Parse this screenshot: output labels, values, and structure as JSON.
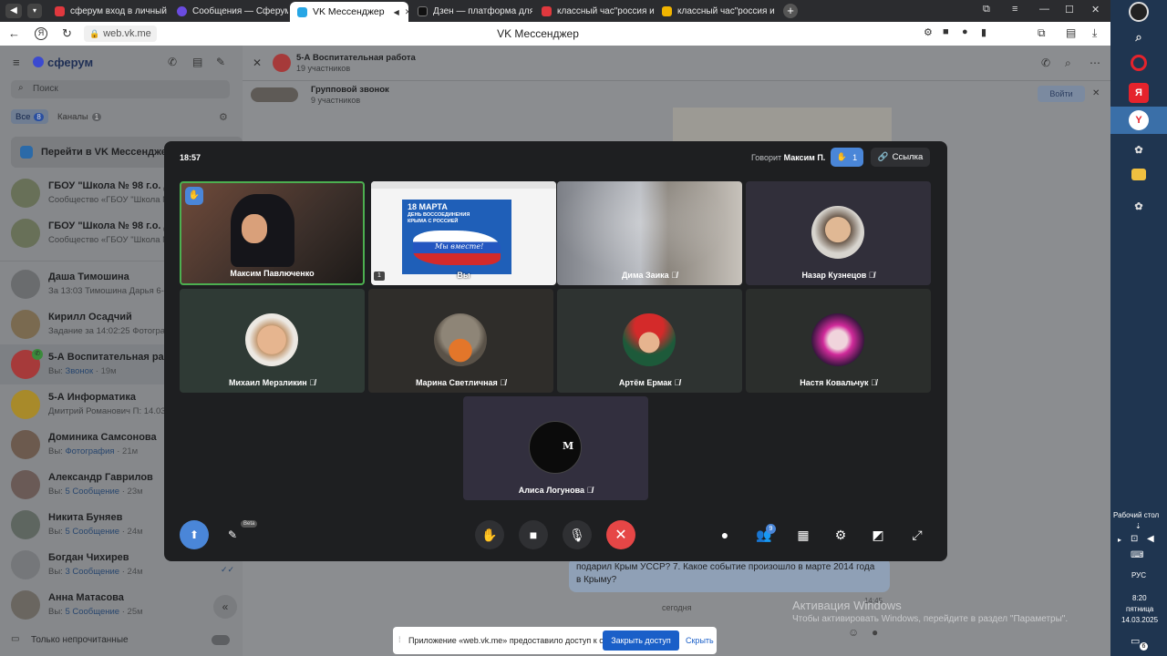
{
  "browser": {
    "tabs": [
      {
        "label": "сферум вход в личный ка",
        "color": "#e0383e"
      },
      {
        "label": "Сообщения — Сферум",
        "color": "#6a4be0"
      },
      {
        "label": "VK Мессенджер",
        "color": "#27a6e5",
        "active": true
      },
      {
        "label": "Дзен — платформа для п",
        "color": "#111111"
      },
      {
        "label": "классный час\"россия и к",
        "color": "#e0383e"
      },
      {
        "label": "классный час\"россия и к",
        "color": "#f0b400"
      }
    ],
    "url": "web.vk.me",
    "page_title": "VK Мессенджер"
  },
  "sidebar": {
    "app_name": "сферум",
    "search_placeholder": "Поиск",
    "filter_all": "Все",
    "filter_all_count": "8",
    "filter_channels": "Каналы",
    "filter_channels_count": "1",
    "goto_messenger": "Перейти в VK Мессенджер",
    "chats": [
      {
        "name": "ГБОУ \"Школа № 98 г.о. Дон",
        "preview": "Сообщество «ГБОУ \"Школа N",
        "time": ""
      },
      {
        "name": "ГБОУ \"Школа № 98 г.о. Дон",
        "preview": "Сообщество «ГБОУ \"Школа N",
        "time": ""
      },
      {
        "name": "Даша Тимошина",
        "preview": "За 13:03 Тимошина Дарья 6-",
        "time": ""
      },
      {
        "name": "Кирилл Осадчий",
        "preview": "Задание за 14:02:25 Фотогра",
        "time": ""
      },
      {
        "name": "5-А Воспитательная работа",
        "preview_prefix": "Вы:",
        "preview": "Звонок",
        "time": "19м"
      },
      {
        "name": "5-А Информатика",
        "preview": "Дмитрий Романович П: 14.03",
        "time": ""
      },
      {
        "name": "Доминика Самсонова",
        "preview_prefix": "Вы:",
        "preview": "Фотография",
        "time": "21м"
      },
      {
        "name": "Александр Гаврилов",
        "preview_prefix": "Вы:",
        "preview": "5 Сообщение",
        "time": "23м"
      },
      {
        "name": "Никита Буняев",
        "preview_prefix": "Вы:",
        "preview": "5 Сообщение",
        "time": "24м"
      },
      {
        "name": "Богдан Чихирев",
        "preview_prefix": "Вы:",
        "preview": "3 Сообщение",
        "time": "24м"
      },
      {
        "name": "Анна Матасова",
        "preview_prefix": "Вы:",
        "preview": "5 Сообщение",
        "time": "25м"
      }
    ],
    "unread_only": "Только непрочитанные"
  },
  "chat": {
    "title": "5-А Воспитательная работа",
    "members": "19 участников",
    "group_call": "Групповой звонок",
    "call_members": "9 участников",
    "join": "Войти",
    "message_text": "подарил Крым УССР?  7. Какое событие произошло в марте 2014 года в Крыму?",
    "message_time": "14:45",
    "date_divider": "сегодня"
  },
  "call": {
    "timer": "18:57",
    "speaking_label": "Говорит",
    "speaking_name": "Максим П.",
    "hands_count": "1",
    "link_label": "Ссылка",
    "beta": "Beta",
    "participants": [
      {
        "name": "Максим Павлюченко",
        "muted": false
      },
      {
        "name": "Вы",
        "muted": false
      },
      {
        "name": "Дима Заика",
        "muted": true
      },
      {
        "name": "Назар Кузнецов",
        "muted": true
      },
      {
        "name": "Михаил Мерзликин",
        "muted": true
      },
      {
        "name": "Марина Светличная",
        "muted": true
      },
      {
        "name": "Артём Ермак",
        "muted": true
      },
      {
        "name": "Настя Ковальчук",
        "muted": true
      },
      {
        "name": "Алиса Логунова",
        "muted": true
      }
    ],
    "slide_date": "18 МАРТА",
    "slide_title": "ДЕНЬ ВОССОЕДИНЕНИЯ КРЫМА С РОССИЕЙ",
    "slide_motto": "Мы вместе!",
    "screen_badge": "1",
    "participants_count": "9",
    "alisa_avatar_letter": "M"
  },
  "permission_bar": {
    "text": "Приложение «web.vk.me» предоставило доступ к окну.",
    "close_access": "Закрыть доступ",
    "hide": "Скрыть"
  },
  "windows": {
    "activation_title": "Активация Windows",
    "activation_text": "Чтобы активировать Windows, перейдите в раздел \"Параметры\".",
    "desktop_label": "Рабочий стол",
    "lang": "РУС",
    "time": "8:20",
    "weekday": "пятница",
    "date": "14.03.2025",
    "notif_count": "6"
  }
}
